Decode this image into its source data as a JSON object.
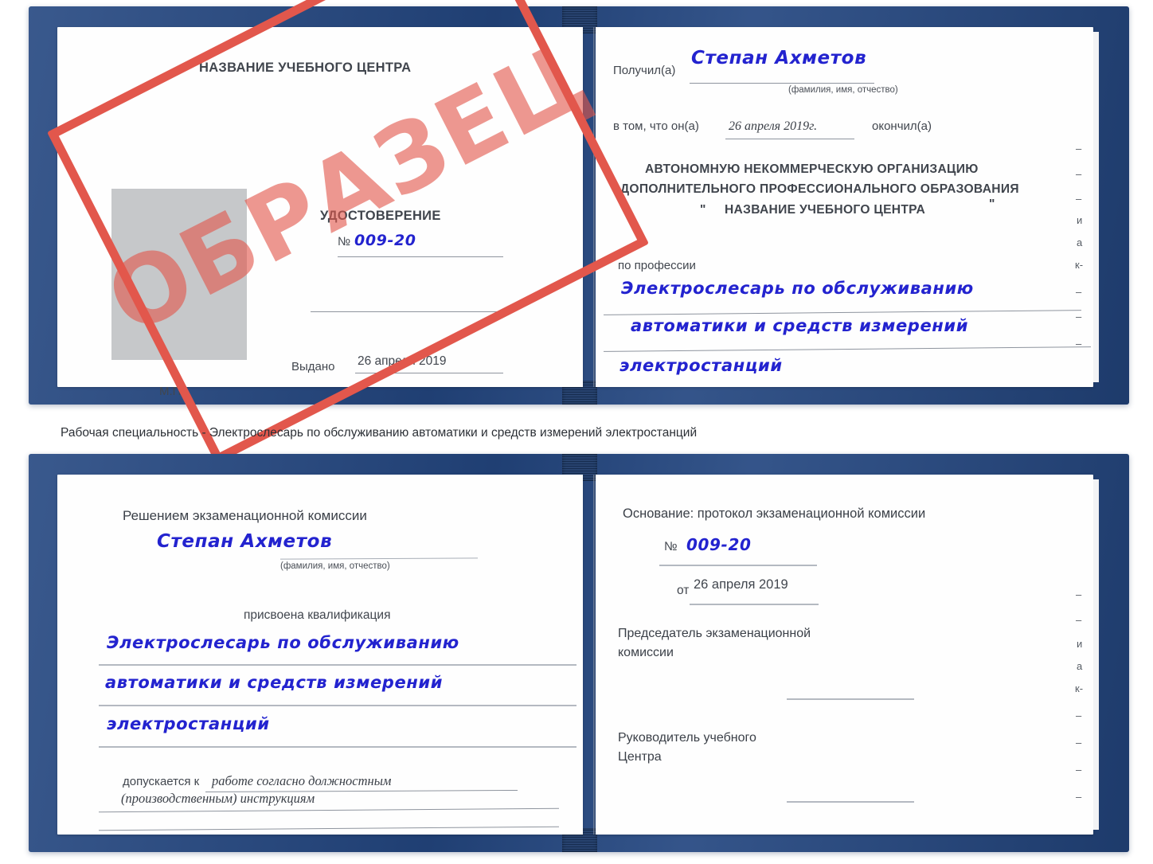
{
  "meta": {
    "doc_kind": "Удостоверение (образец)",
    "accent_red": "#e2574c",
    "cover_blue": "#234680",
    "ink_blue": "#2323cf",
    "paper": "#fefefe"
  },
  "stamp": {
    "label": "ОБРАЗЕЦ"
  },
  "caption": {
    "text": "Рабочая специальность - Электрослесарь по обслуживанию автоматики и средств измерений электростанций"
  },
  "cert_top": {
    "left_page": {
      "center_name": "НАЗВАНИЕ УЧЕБНОГО ЦЕНТРА",
      "title": "УДОСТОВЕРЕНИЕ",
      "number_label": "№",
      "number_value": "009-20",
      "issued_label": "Выдано",
      "issued_value": "26 апреля 2019",
      "seal_label": "М.П."
    },
    "right_page": {
      "received_label": "Получил(а)",
      "received_value": "Степан Ахметов",
      "fio_hint": "(фамилия, имя, отчество)",
      "that_he_label": "в том, что он(а)",
      "date_value": "26 апреля 2019г.",
      "graduated_label": "окончил(а)",
      "org_line1": "АВТОНОМНУЮ НЕКОММЕРЧЕСКУЮ ОРГАНИЗАЦИЮ",
      "org_line2": "ДОПОЛНИТЕЛЬНОГО ПРОФЕССИОНАЛЬНОГО ОБРАЗОВАНИЯ",
      "org_quote_open": "\"",
      "org_line3": "НАЗВАНИЕ УЧЕБНОГО ЦЕНТРА",
      "org_quote_close": "\"",
      "profession_label": "по профессии",
      "profession_line1": "Электрослесарь по обслуживанию",
      "profession_line2": "автоматики и средств измерений",
      "profession_line3": "электростанций",
      "bleed_glyphs": [
        "–",
        "–",
        "–",
        "и",
        "а",
        "к-"
      ]
    }
  },
  "cert_bottom": {
    "left_page": {
      "decision_label": "Решением экзаменационной комиссии",
      "name_value": "Степан Ахметов",
      "fio_hint": "(фамилия, имя, отчество)",
      "qualification_label": "присвоена квалификация",
      "qualification_line1": "Электрослесарь по обслуживанию",
      "qualification_line2": "автоматики и средств измерений",
      "qualification_line3": "электростанций",
      "allowed_label": "допускается к",
      "allowed_value_line1": "работе согласно должностным",
      "allowed_value_line2": "(производственным) инструкциям"
    },
    "right_page": {
      "basis_label": "Основание: протокол экзаменационной комиссии",
      "number_label": "№",
      "number_value": "009-20",
      "date_label": "от",
      "date_value": "26 апреля 2019",
      "chairman_line1": "Председатель экзаменационной",
      "chairman_line2": "комиссии",
      "head_line1": "Руководитель учебного",
      "head_line2": "Центра",
      "bleed_glyphs": [
        "–",
        "–",
        "и",
        "а",
        "к-",
        "–",
        "–",
        "–",
        "–"
      ]
    }
  }
}
